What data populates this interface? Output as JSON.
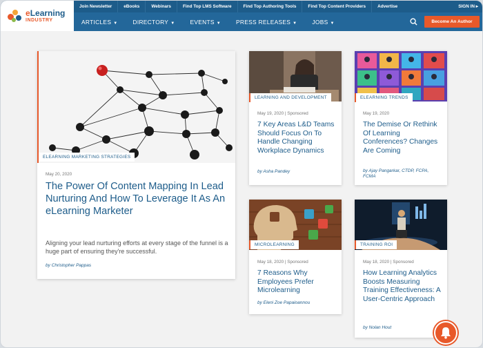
{
  "logo": {
    "line1_a": "e",
    "line1_b": "Learning",
    "line2": "INDUSTRY"
  },
  "topbar": {
    "links": [
      "Join Newsletter",
      "eBooks",
      "Webinars",
      "Find Top LMS Software",
      "Find Top Authoring Tools",
      "Find Top Content Providers",
      "Advertise"
    ],
    "signin": "SIGN IN ▸"
  },
  "nav": {
    "items": [
      "ARTICLES",
      "DIRECTORY",
      "EVENTS",
      "PRESS RELEASES",
      "JOBS"
    ],
    "caret": "▼",
    "cta": "Become An Author"
  },
  "featured": {
    "category": "ELEARNING MARKETING STRATEGIES",
    "date": "May 20, 2020",
    "title": "The Power Of Content Mapping In Lead Nurturing And How To Leverage It As An eLearning Marketer",
    "excerpt": "Aligning your lead nurturing efforts at every stage of the funnel is a huge part of ensuring they're successful.",
    "author": "by Christopher Pappas"
  },
  "cards": [
    {
      "category": "LEARNING AND DEVELOPMENT",
      "meta": "May 19, 2020 | Sponsored",
      "title": "7 Key Areas L&D Teams Should Focus On To Handle Changing Workplace Dynamics",
      "author": "by Asha Pandey"
    },
    {
      "category": "ELEARNING TRENDS",
      "meta": "May 19, 2020",
      "title": "The Demise Or Rethink Of Learning Conferences? Changes Are Coming",
      "author": "by Ajay Pangarkar, CTDP, FCPA, FCMA"
    },
    {
      "category": "MICROLEARNING",
      "meta": "May 18, 2020 | Sponsored",
      "title": "7 Reasons Why Employees Prefer Microlearning",
      "author": "by Eleni Zoe Papaioannou"
    },
    {
      "category": "TRAINING ROI",
      "meta": "May 18, 2020 | Sponsored",
      "title": "How Learning Analytics Boosts Measuring Training Effectiveness: A User-Centric Approach",
      "author": "by Nolan Hout"
    }
  ],
  "colors": {
    "brand": "#1d5c8a",
    "accent": "#e8592a",
    "nav": "#23679a"
  },
  "icons": {
    "search": "search-icon",
    "bell": "notification-bell-icon"
  }
}
